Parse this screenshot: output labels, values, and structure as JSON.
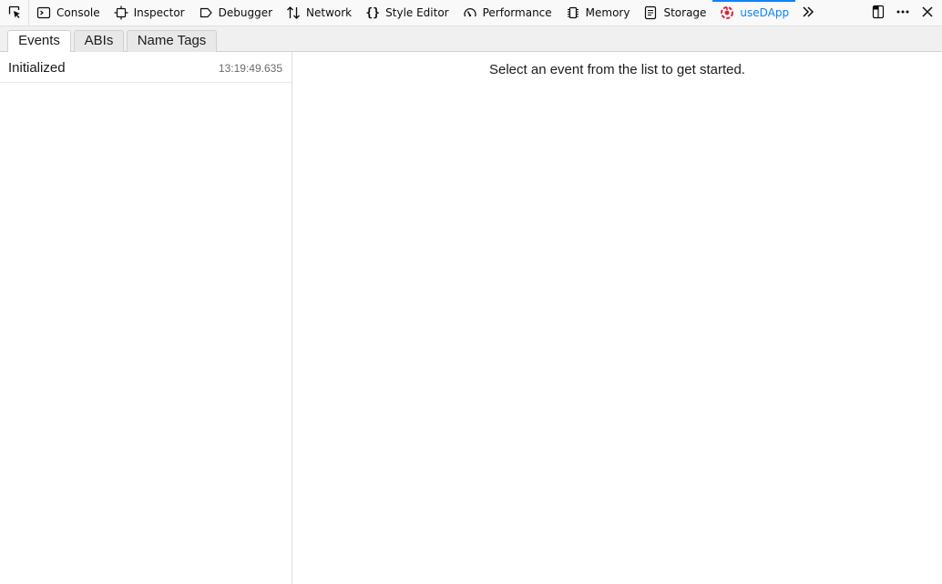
{
  "toolbar": {
    "picker_icon": "element-picker-icon",
    "tabs": [
      {
        "label": "Console",
        "icon": "console-icon"
      },
      {
        "label": "Inspector",
        "icon": "inspector-icon"
      },
      {
        "label": "Debugger",
        "icon": "debugger-icon"
      },
      {
        "label": "Network",
        "icon": "network-icon"
      },
      {
        "label": "Style Editor",
        "icon": "style-editor-icon"
      },
      {
        "label": "Performance",
        "icon": "performance-icon"
      },
      {
        "label": "Memory",
        "icon": "memory-icon"
      },
      {
        "label": "Storage",
        "icon": "storage-icon"
      },
      {
        "label": "useDApp",
        "icon": "usedapp-icon",
        "selected": true
      }
    ],
    "overflow_icon": "chevrons-right-icon",
    "right_icons": [
      "dock-icon",
      "more-options-icon",
      "close-icon"
    ],
    "accent_color": "#0a84ff"
  },
  "panel": {
    "tabs": [
      {
        "label": "Events",
        "active": true
      },
      {
        "label": "ABIs",
        "active": false
      },
      {
        "label": "Name Tags",
        "active": false
      }
    ],
    "events": [
      {
        "name": "Initialized",
        "time": "13:19:49.635"
      }
    ],
    "placeholder": "Select an event from the list to get started."
  }
}
